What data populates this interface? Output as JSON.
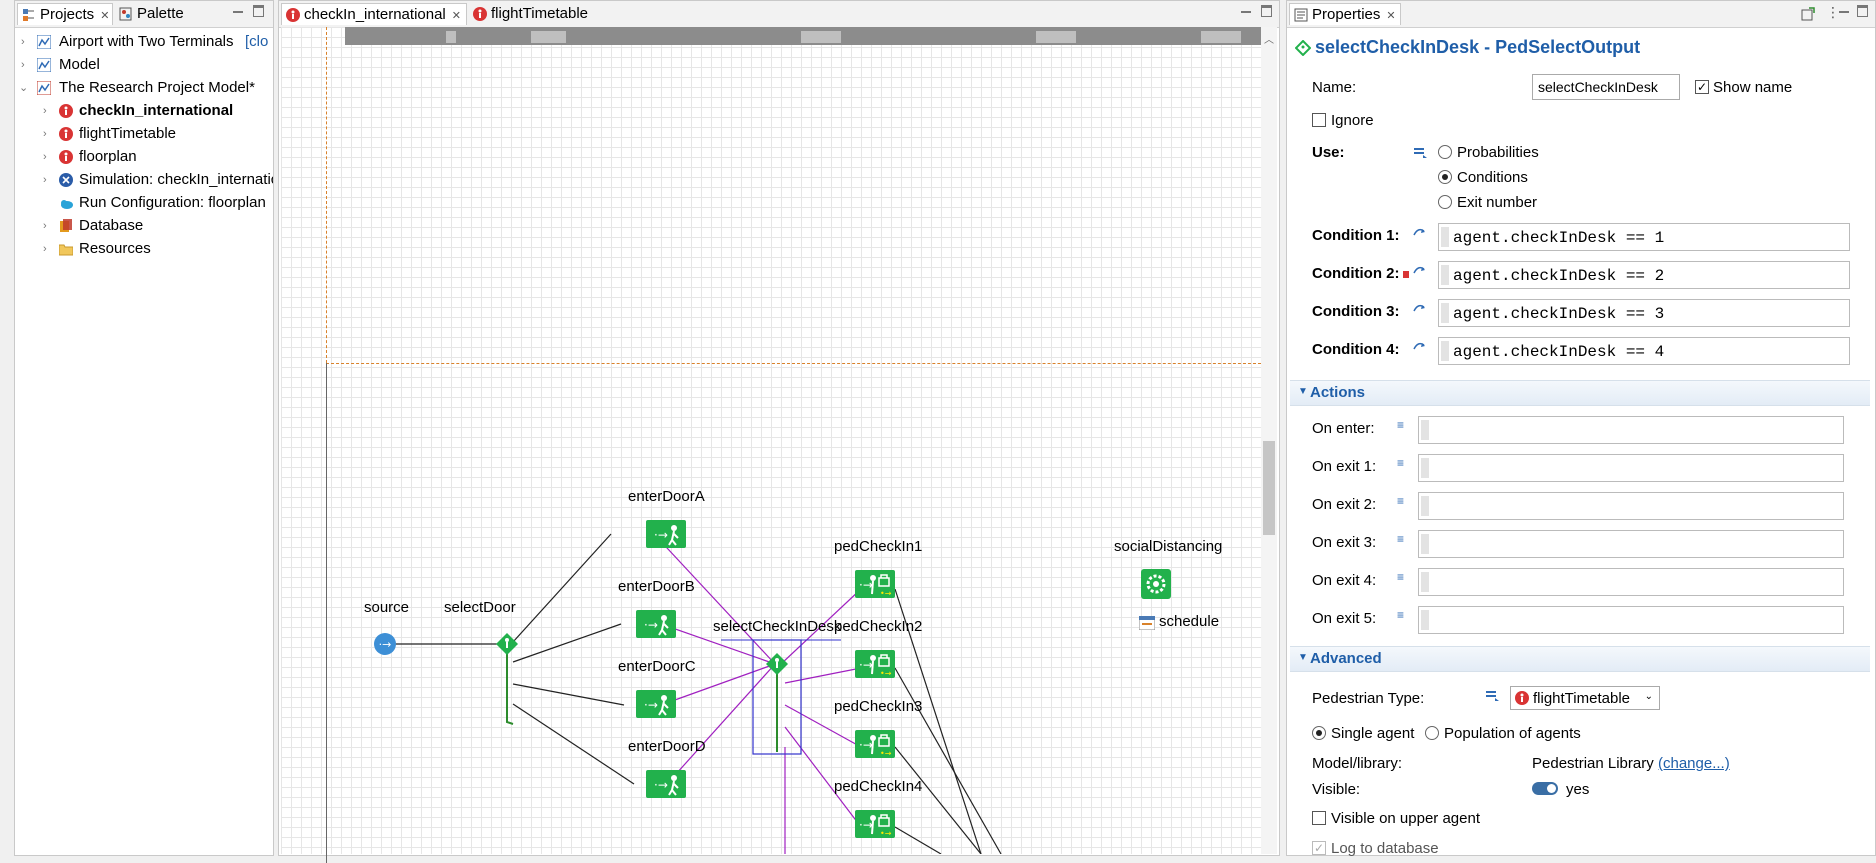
{
  "projects_panel": {
    "tabs": [
      {
        "label": "Projects"
      },
      {
        "label": "Palette"
      }
    ],
    "tree": [
      {
        "label": "Airport with Two Terminals",
        "suffix": "[clo",
        "level": 0,
        "expand": "›"
      },
      {
        "label": "Model",
        "level": 0,
        "expand": "›"
      },
      {
        "label": "The Research Project Model*",
        "level": 0,
        "expand": "⌄"
      },
      {
        "label": "checkIn_international",
        "level": 1,
        "expand": "›",
        "bold": true
      },
      {
        "label": "flightTimetable",
        "level": 1,
        "expand": "›"
      },
      {
        "label": "floorplan",
        "level": 1,
        "expand": "›"
      },
      {
        "label": "Simulation: checkIn_internatic",
        "level": 1,
        "expand": "›"
      },
      {
        "label": "Run Configuration: floorplan",
        "level": 1,
        "expand": ""
      },
      {
        "label": "Database",
        "level": 1,
        "expand": "›"
      },
      {
        "label": "Resources",
        "level": 1,
        "expand": "›"
      }
    ]
  },
  "editor": {
    "tabs": [
      {
        "label": "checkIn_international"
      },
      {
        "label": "flightTimetable"
      }
    ],
    "blocks": {
      "source": "source",
      "selectDoor": "selectDoor",
      "enterDoorA": "enterDoorA",
      "enterDoorB": "enterDoorB",
      "enterDoorC": "enterDoorC",
      "enterDoorD": "enterDoorD",
      "selectCheckInDesk": "selectCheckInDesk",
      "pedCheckIn1": "pedCheckIn1",
      "pedCheckIn2": "pedCheckIn2",
      "pedCheckIn3": "pedCheckIn3",
      "pedCheckIn4": "pedCheckIn4",
      "socialDistancing": "socialDistancing",
      "schedule": "schedule"
    }
  },
  "properties": {
    "tab_label": "Properties",
    "title": "selectCheckInDesk - PedSelectOutput",
    "name_label": "Name:",
    "name_value": "selectCheckInDesk",
    "show_name": "Show name",
    "ignore": "Ignore",
    "use_label": "Use:",
    "use_options": [
      "Probabilities",
      "Conditions",
      "Exit number"
    ],
    "use_selected": "Conditions",
    "conditions": [
      {
        "label": "Condition 1:",
        "value": "agent.checkInDesk == 1"
      },
      {
        "label": "Condition 2:",
        "value": "agent.checkInDesk == 2"
      },
      {
        "label": "Condition 3:",
        "value": "agent.checkInDesk == 3"
      },
      {
        "label": "Condition 4:",
        "value": "agent.checkInDesk == 4"
      }
    ],
    "actions_header": "Actions",
    "actions": [
      "On enter:",
      "On exit 1:",
      "On exit 2:",
      "On exit 3:",
      "On exit 4:",
      "On exit 5:"
    ],
    "advanced_header": "Advanced",
    "ped_type_label": "Pedestrian Type:",
    "ped_type_value": "flightTimetable",
    "single_agent": "Single agent",
    "population": "Population of agents",
    "model_library_label": "Model/library:",
    "model_library_value": "Pedestrian Library",
    "change_link": "(change...)",
    "visible_label": "Visible:",
    "visible_value": "yes",
    "visible_upper": "Visible on upper agent",
    "log_db": "Log to database"
  }
}
